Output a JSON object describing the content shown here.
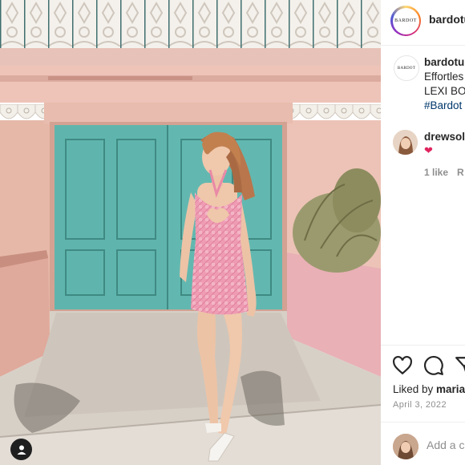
{
  "post": {
    "account": "bardotu",
    "avatar_brand": "BARDOT",
    "caption_user": "bardotu",
    "caption_lines": [
      "Effortles",
      "LEXI BO"
    ],
    "caption_hashtag": "#Bardot",
    "comment": {
      "user": "drewsol",
      "heart": "❤",
      "likes": "1 like",
      "reply": "R"
    },
    "liked_by_prefix": "Liked by ",
    "liked_by_user": "maria",
    "date": "April 3, 2022",
    "comment_placeholder": "Add a c"
  },
  "icons": {
    "like": "heart-outline-icon",
    "comment": "comment-bubble-icon",
    "share": "paper-plane-icon",
    "tag": "user-tag-icon"
  },
  "colors": {
    "door": "#5fb5ad",
    "dress": "#e98aa6",
    "wall": "#e9b6a8",
    "hashtag": "#00376b",
    "heart": "#e0245e"
  }
}
